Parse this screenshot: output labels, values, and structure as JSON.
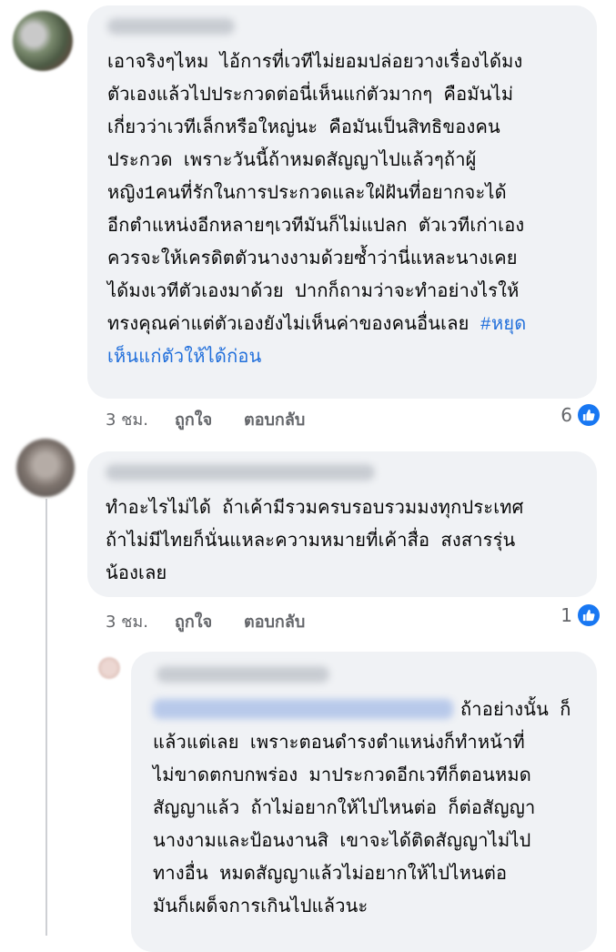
{
  "comments": [
    {
      "text_lines": [
        "เอาจริงๆไหม ไอ้การที่เวทีไม่ยอมปล่อยวางเรื่องได้มง",
        "ตัวเองแล้วไปประกวดต่อนี่เห็นแก่ตัวมากๆ คือมันไม่",
        "เกี่ยวว่าเวทีเล็กหรือใหญ่นะ คือมันเป็นสิทธิของคน",
        "ประกวด เพราะวันนี้ถ้าหมดสัญญาไปแล้วๆถ้าผู้",
        "หญิง1คนที่รักในการประกวดและใฝ่ฝันที่อยากจะได้",
        "อีกตำแหน่งอีกหลายๆเวทีมันก็ไม่แปลก ตัวเวทีเก่าเอง",
        "ควรจะให้เครดิตตัวนางงามด้วยซ้ำว่านี่แหละนางเคย",
        "ได้มงเวทีตัวเองมาด้วย ปากก็ถามว่าจะทำอย่างไรให้",
        "ทรงคุณค่าแต่ตัวเองยังไม่เห็นค่าของคนอื่นเลย "
      ],
      "hashtag_part1": "#หยุด",
      "hashtag_part2": "เห็นแก่ตัวให้ได้ก่อน",
      "time": "3 ชม.",
      "like_label": "ถูกใจ",
      "reply_label": "ตอบกลับ",
      "reaction_count": "6",
      "reaction_icon": "like-thumb-icon"
    },
    {
      "text_lines": [
        "ทำอะไรไม่ได้ ถ้าเค้ามีรวมครบรอบรวมมงทุกประเทศ",
        "ถ้าไม่มีไทยก็นั่นแหละความหมายที่เค้าสื่อ สงสารรุ่น",
        "น้องเลย"
      ],
      "time": "3 ชม.",
      "like_label": "ถูกใจ",
      "reply_label": "ตอบกลับ",
      "reaction_count": "1",
      "reaction_icon": "like-thumb-icon"
    },
    {
      "first_line_tail": "ถ้าอย่างนั้น ก็",
      "text_lines": [
        "แล้วแต่เลย เพราะตอนดำรงตำแหน่งก็ทำหน้าที่",
        "ไม่ขาดตกบกพร่อง มาประกวดอีกเวทีก็ตอนหมด",
        "สัญญาแล้ว ถ้าไม่อยากให้ไปไหนต่อ ก็ต่อสัญญา",
        "นางงามและป้อนงานสิ เขาจะได้ติดสัญญาไม่ไป",
        "ทางอื่น หมดสัญญาแล้วไม่อยากให้ไปไหนต่อ",
        "มันก็เผด็จการเกินไปแล้วนะ"
      ]
    }
  ],
  "colors": {
    "bubble": "#f0f2f5",
    "text": "#050505",
    "meta": "#65676b",
    "link": "#216fdb",
    "like_blue": "#1877f2"
  }
}
